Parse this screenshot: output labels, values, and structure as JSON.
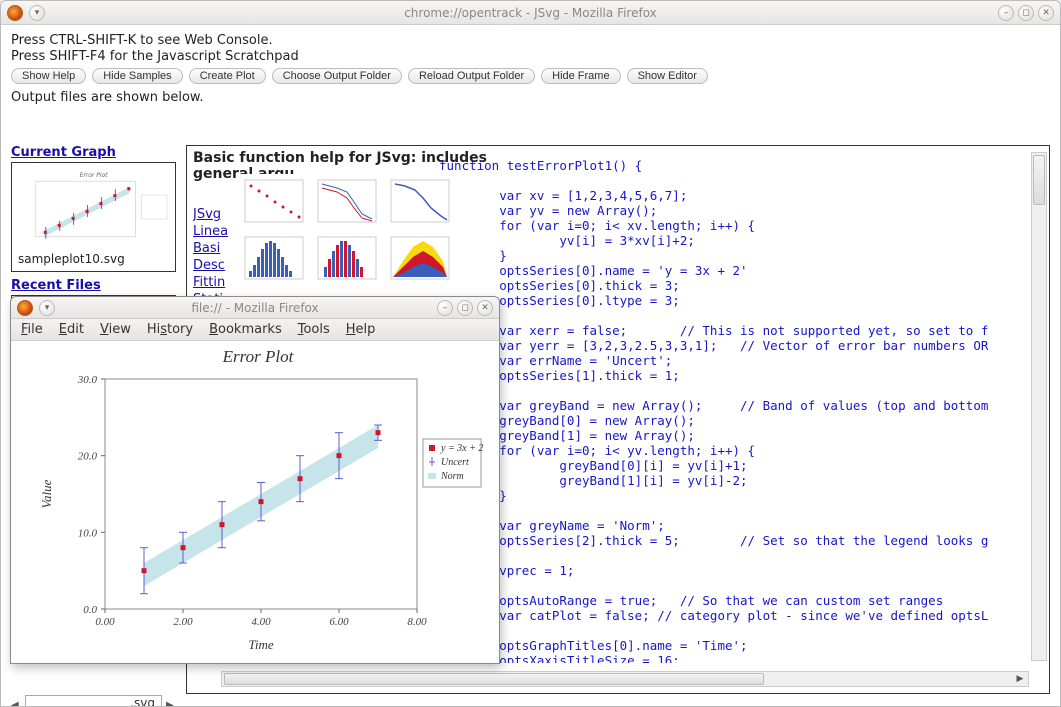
{
  "main_window": {
    "title": "chrome://opentrack - JSvg - Mozilla Firefox"
  },
  "help_lines": [
    "Press CTRL-SHIFT-K to see Web Console.",
    "Press SHIFT-F4 for the Javascript Scratchpad"
  ],
  "toolbar": [
    "Show Help",
    "Hide Samples",
    "Create Plot",
    "Choose Output Folder",
    "Reload Output Folder",
    "Hide Frame",
    "Show Editor"
  ],
  "output_note": "Output files are shown below.",
  "sections": {
    "current": "Current Graph",
    "recent": "Recent Files"
  },
  "thumb_caption": "sampleplot10.svg",
  "ext_value": ".svg",
  "doc": {
    "title": "Basic function help for JSvg: includes general argu",
    "links": [
      "JSvg",
      "Linea",
      "Basi",
      "Desc",
      "Fittin",
      "Stati"
    ]
  },
  "code": "function testErrorPlot1() {\n\n        var xv = [1,2,3,4,5,6,7];\n        var yv = new Array();\n        for (var i=0; i< xv.length; i++) {\n                yv[i] = 3*xv[i]+2;\n        }\n        optsSeries[0].name = 'y = 3x + 2'\n        optsSeries[0].thick = 3;\n        optsSeries[0].ltype = 3;\n\n        var xerr = false;       // This is not supported yet, so set to f\n        var yerr = [3,2,3,2.5,3,3,1];   // Vector of error bar numbers OR\n        var errName = 'Uncert';\n        optsSeries[1].thick = 1;\n\n        var greyBand = new Array();     // Band of values (top and bottom\n        greyBand[0] = new Array();\n        greyBand[1] = new Array();\n        for (var i=0; i< yv.length; i++) {\n                greyBand[0][i] = yv[i]+1;\n                greyBand[1][i] = yv[i]-2;\n        }\n\n        var greyName = 'Norm';\n        optsSeries[2].thick = 5;        // Set so that the legend looks g\n\n        vprec = 1;\n\n        optsAutoRange = true;   // So that we can custom set ranges\n        var catPlot = false; // category plot - since we've defined optsL\n\n        optsGraphTitles[0].name = 'Time';\n        optsXaxisTitleSize = 16;",
  "popup": {
    "title": "file:// - Mozilla Firefox",
    "menus": [
      "File",
      "Edit",
      "View",
      "History",
      "Bookmarks",
      "Tools",
      "Help"
    ]
  },
  "chart_data": {
    "type": "scatter",
    "title": "Error Plot",
    "xlabel": "Time",
    "ylabel": "Value",
    "xlim": [
      0,
      8
    ],
    "ylim": [
      0,
      30
    ],
    "xticks": [
      0.0,
      2.0,
      4.0,
      6.0,
      8.0
    ],
    "yticks": [
      0.0,
      10.0,
      20.0,
      30.0
    ],
    "x": [
      1,
      2,
      3,
      4,
      5,
      6,
      7
    ],
    "y": [
      5,
      8,
      11,
      14,
      17,
      20,
      23
    ],
    "yerr": [
      3,
      2,
      3,
      2.5,
      3,
      3,
      1
    ],
    "band_upper": [
      6,
      9,
      12,
      15,
      18,
      21,
      24
    ],
    "band_lower": [
      3,
      6,
      9,
      12,
      15,
      18,
      21
    ],
    "legend": [
      {
        "name": "y = 3x + 2",
        "marker": "square",
        "color": "#d01628"
      },
      {
        "name": "Uncert",
        "marker": "err",
        "color": "#5a5fd6"
      },
      {
        "name": "Norm",
        "marker": "band",
        "color": "#c6e5ea"
      }
    ]
  }
}
